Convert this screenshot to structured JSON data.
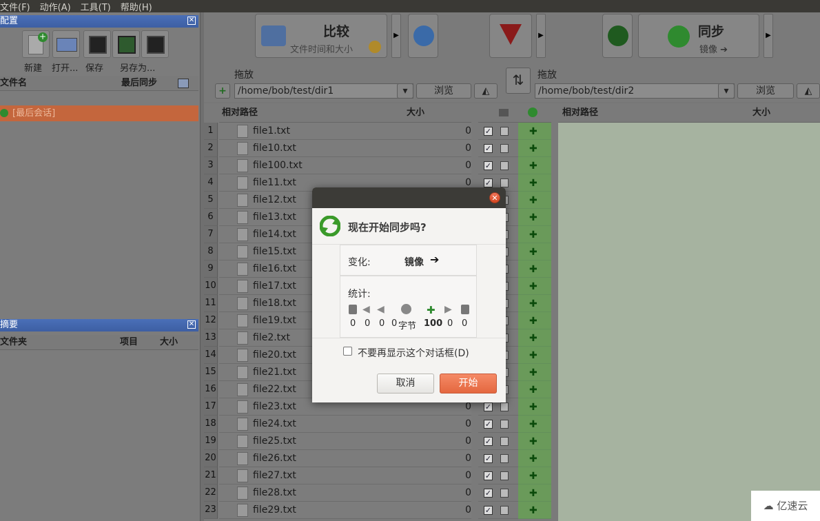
{
  "menu": [
    "文件(F)",
    "动作(A)",
    "工具(T)",
    "帮助(H)"
  ],
  "config_panel": {
    "title": "配置",
    "buttons": [
      {
        "label": "新建",
        "icon": "new-icon"
      },
      {
        "label": "打开...",
        "icon": "open-icon"
      },
      {
        "label": "保存",
        "icon": "save-icon"
      },
      {
        "label": "另存为...",
        "icon": "save-as-icon"
      }
    ],
    "col_name": "文件名",
    "col_last_sync": "最后同步",
    "row": "[最后会话]"
  },
  "summary_panel": {
    "title": "摘要",
    "col_folder": "文件夹",
    "col_items": "项目",
    "col_size": "大小"
  },
  "compare": {
    "label": "比较",
    "sub": "文件时间和大小"
  },
  "sync": {
    "label": "同步",
    "sub": "镜像 ➔"
  },
  "left_path": {
    "drag_label": "拖放",
    "path": "/home/bob/test/dir1",
    "browse": "浏览"
  },
  "right_path": {
    "drag_label": "拖放",
    "path": "/home/bob/test/dir2",
    "browse": "浏览"
  },
  "grid": {
    "col_rel_path": "相对路径",
    "col_size": "大小",
    "right_col_rel_path": "相对路径",
    "right_col_size": "大小"
  },
  "rows": [
    {
      "n": "1",
      "name": "file1.txt",
      "size": "0"
    },
    {
      "n": "2",
      "name": "file10.txt",
      "size": "0"
    },
    {
      "n": "3",
      "name": "file100.txt",
      "size": "0"
    },
    {
      "n": "4",
      "name": "file11.txt",
      "size": "0"
    },
    {
      "n": "5",
      "name": "file12.txt",
      "size": "0"
    },
    {
      "n": "6",
      "name": "file13.txt",
      "size": "0"
    },
    {
      "n": "7",
      "name": "file14.txt",
      "size": "0"
    },
    {
      "n": "8",
      "name": "file15.txt",
      "size": "0"
    },
    {
      "n": "9",
      "name": "file16.txt",
      "size": "0"
    },
    {
      "n": "10",
      "name": "file17.txt",
      "size": "0"
    },
    {
      "n": "11",
      "name": "file18.txt",
      "size": "0"
    },
    {
      "n": "12",
      "name": "file19.txt",
      "size": "0"
    },
    {
      "n": "13",
      "name": "file2.txt",
      "size": "0"
    },
    {
      "n": "14",
      "name": "file20.txt",
      "size": "0"
    },
    {
      "n": "15",
      "name": "file21.txt",
      "size": "0"
    },
    {
      "n": "16",
      "name": "file22.txt",
      "size": "0"
    },
    {
      "n": "17",
      "name": "file23.txt",
      "size": "0"
    },
    {
      "n": "18",
      "name": "file24.txt",
      "size": "0"
    },
    {
      "n": "19",
      "name": "file25.txt",
      "size": "0"
    },
    {
      "n": "20",
      "name": "file26.txt",
      "size": "0"
    },
    {
      "n": "21",
      "name": "file27.txt",
      "size": "0"
    },
    {
      "n": "22",
      "name": "file28.txt",
      "size": "0"
    },
    {
      "n": "23",
      "name": "file29.txt",
      "size": "0"
    }
  ],
  "dialog": {
    "heading": "现在开始同步吗?",
    "change_label": "变化:",
    "change_value": "镜像",
    "stats_label": "统计:",
    "stats": [
      "0",
      "0",
      "0",
      "0",
      "字节",
      "100",
      "0",
      "0"
    ],
    "checkbox_label": "不要再显示这个对话框(D)",
    "cancel": "取消",
    "start": "开始"
  },
  "watermark": "亿速云",
  "colors": {
    "accent": "#e4673f",
    "sync_green": "#6a9a5a",
    "selected_row": "#c4663d"
  }
}
